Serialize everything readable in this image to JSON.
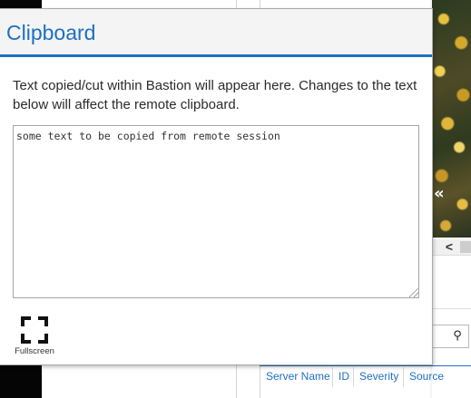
{
  "clipboard_panel": {
    "title": "Clipboard",
    "description": "Text copied/cut within Bastion will appear here. Changes to the text below will affect the remote clipboard.",
    "text_content": "some text to be copied from remote session",
    "fullscreen_label": "Fullscreen"
  },
  "background": {
    "collapse_icon": "«",
    "scroll_left_icon": "<",
    "search_icon": "⚲",
    "table_columns": [
      "Server Name",
      "ID",
      "Severity",
      "Source"
    ]
  },
  "colors": {
    "accent": "#1c6fc4",
    "panel_header_bg": "#f4f4f4",
    "text": "#2b2b2b"
  }
}
